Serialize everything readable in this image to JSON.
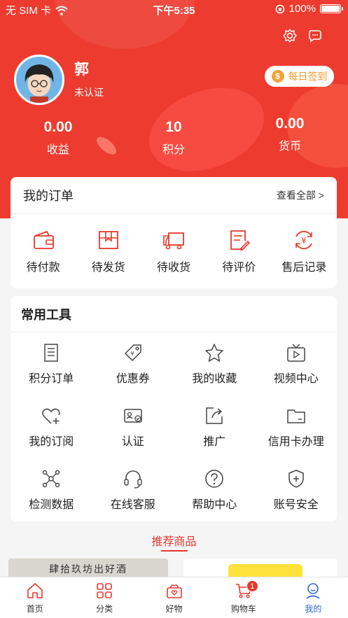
{
  "status": {
    "carrier": "无 SIM 卡",
    "time": "下午5:35",
    "battery": "100%"
  },
  "profile": {
    "name": "郭",
    "status": "未认证",
    "signin_label": "每日签到",
    "coin_symbol": "$"
  },
  "stats": [
    {
      "value": "0.00",
      "label": "收益"
    },
    {
      "value": "10",
      "label": "积分"
    },
    {
      "value": "0.00",
      "label": "货币"
    }
  ],
  "orders": {
    "title": "我的订单",
    "more": "查看全部 >",
    "items": [
      {
        "label": "待付款",
        "icon": "wallet-icon"
      },
      {
        "label": "待发货",
        "icon": "box-icon"
      },
      {
        "label": "待收货",
        "icon": "truck-icon"
      },
      {
        "label": "待评价",
        "icon": "review-icon"
      },
      {
        "label": "售后记录",
        "icon": "refund-icon"
      }
    ]
  },
  "tools": {
    "title": "常用工具",
    "items": [
      {
        "label": "积分订单",
        "icon": "document-icon"
      },
      {
        "label": "优惠券",
        "icon": "coupon-tag-icon"
      },
      {
        "label": "我的收藏",
        "icon": "star-icon"
      },
      {
        "label": "视频中心",
        "icon": "tv-icon"
      },
      {
        "label": "我的订阅",
        "icon": "heart-plus-icon"
      },
      {
        "label": "认证",
        "icon": "id-card-icon"
      },
      {
        "label": "推广",
        "icon": "share-icon"
      },
      {
        "label": "信用卡办理",
        "icon": "folder-icon"
      },
      {
        "label": "检测数据",
        "icon": "network-icon"
      },
      {
        "label": "在线客服",
        "icon": "headset-icon"
      },
      {
        "label": "帮助中心",
        "icon": "help-icon"
      },
      {
        "label": "账号安全",
        "icon": "shield-icon"
      }
    ]
  },
  "recommend": {
    "title": "推荐商品",
    "product_left_text": "肆拾玖坊出好酒"
  },
  "tabbar": [
    {
      "label": "首页",
      "icon": "home-icon"
    },
    {
      "label": "分类",
      "icon": "category-icon"
    },
    {
      "label": "好物",
      "icon": "gift-icon"
    },
    {
      "label": "购物车",
      "icon": "cart-icon",
      "badge": "1"
    },
    {
      "label": "我的",
      "icon": "profile-icon",
      "active": true
    }
  ],
  "colors": {
    "primary": "#ee3b2f",
    "accent": "#e8382c",
    "active_tab": "#2e6bd6",
    "coin": "#f3a33a"
  }
}
